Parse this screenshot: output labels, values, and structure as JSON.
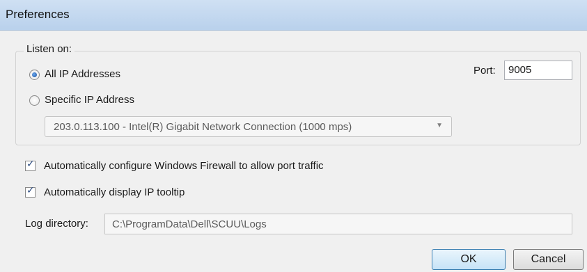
{
  "window": {
    "title": "Preferences"
  },
  "listen": {
    "legend": "Listen on:",
    "options": [
      {
        "label": "All IP Addresses",
        "checked": true
      },
      {
        "label": "Specific IP Address",
        "checked": false
      }
    ],
    "ip_select": {
      "value": "203.0.113.100 - Intel(R) Gigabit Network Connection (1000 mps)"
    },
    "port": {
      "label": "Port:",
      "value": "9005"
    }
  },
  "checkboxes": [
    {
      "label": "Automatically configure Windows Firewall to allow port traffic",
      "checked": true
    },
    {
      "label": "Automatically display IP tooltip",
      "checked": true
    }
  ],
  "log": {
    "label": "Log directory:",
    "value": "C:\\ProgramData\\Dell\\SCUU\\Logs"
  },
  "buttons": {
    "ok": "OK",
    "cancel": "Cancel"
  },
  "icons": {
    "checkmark": "✓",
    "dropdown": "▼"
  }
}
